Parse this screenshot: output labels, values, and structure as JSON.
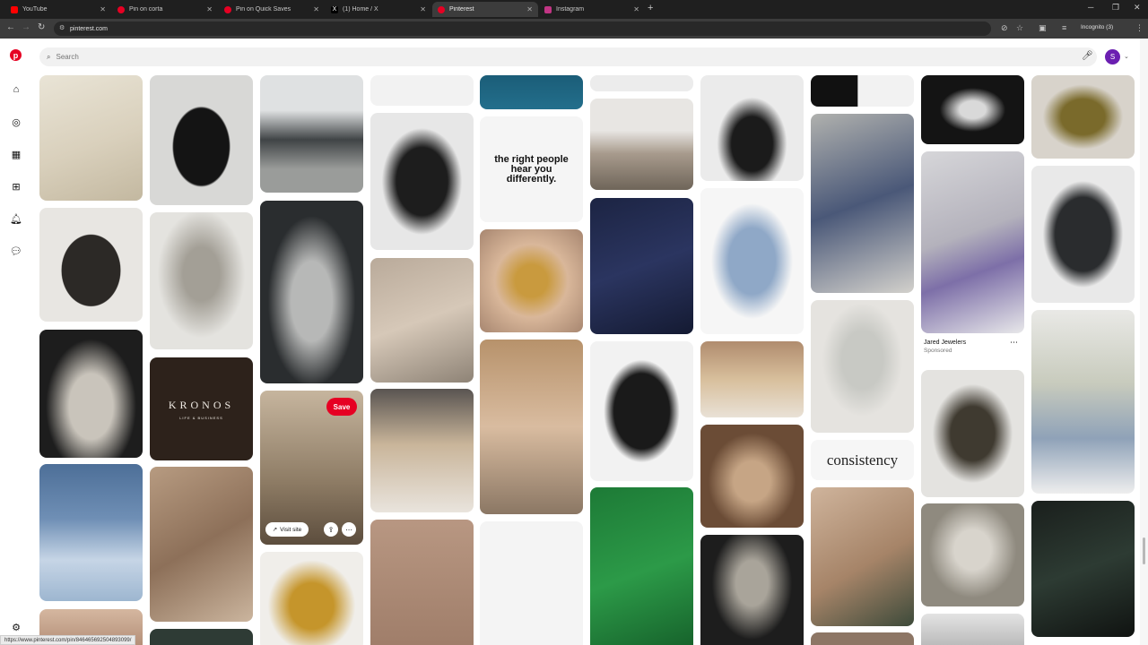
{
  "browser": {
    "tabs": [
      {
        "title": "YouTube",
        "color": "#ff0000",
        "active": false
      },
      {
        "title": "Pin on corta",
        "color": "#e60023",
        "active": false
      },
      {
        "title": "Pin on Quick Saves",
        "color": "#e60023",
        "active": false
      },
      {
        "title": "(1) Home / X",
        "color": "#000000",
        "active": false
      },
      {
        "title": "Pinterest",
        "color": "#e60023",
        "active": true
      },
      {
        "title": "Instagram",
        "color": "#c13584",
        "active": false
      }
    ],
    "url": "pinterest.com",
    "profile_label": "Incognito (3)",
    "status_url": "https://www.pinterest.com/pin/846465692504893099/"
  },
  "pinterest": {
    "logo": "p",
    "search_placeholder": "Search",
    "avatar_initial": "S",
    "rail_icons": [
      "home-icon",
      "explore-icon",
      "boards-icon",
      "create-icon",
      "notifications-icon",
      "messages-icon",
      "settings-icon"
    ],
    "accent": "#e60023"
  },
  "pins": {
    "text_right_people": "the right people hear you differently.",
    "text_kronos": "KRONOS",
    "text_kronos_sub": "LIFE & BUSINESS",
    "text_consistency": "consistency",
    "hover_save": "Save",
    "hover_visit": "Visit site",
    "sponsored_name": "Jared Jewelers",
    "sponsored_label": "Sponsored"
  }
}
